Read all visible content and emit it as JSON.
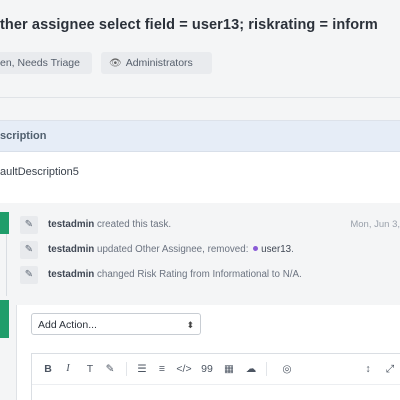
{
  "task": {
    "title": "ther assignee select field = user13; riskrating = inform",
    "tags": {
      "status": "en, Needs Triage",
      "policy": "Administrators"
    }
  },
  "description": {
    "header": "scription",
    "body": "aultDescription5"
  },
  "timeline": [
    {
      "user": "testadmin",
      "text": "created this task.",
      "date": "Mon, Jun 3,"
    },
    {
      "user": "testadmin",
      "text": "updated Other Assignee, removed:",
      "object": "user13",
      "tail": "."
    },
    {
      "user": "testadmin",
      "text": "changed Risk Rating from Informational to N/A."
    }
  ],
  "action": {
    "select_value": "Add Action..."
  },
  "toolbar": {
    "buttons": [
      "B",
      "I",
      "T",
      "✎",
      "☰",
      "≡",
      "</>",
      "99",
      "▦",
      "☁",
      "◎",
      "↕",
      "⤢",
      "↹"
    ]
  }
}
